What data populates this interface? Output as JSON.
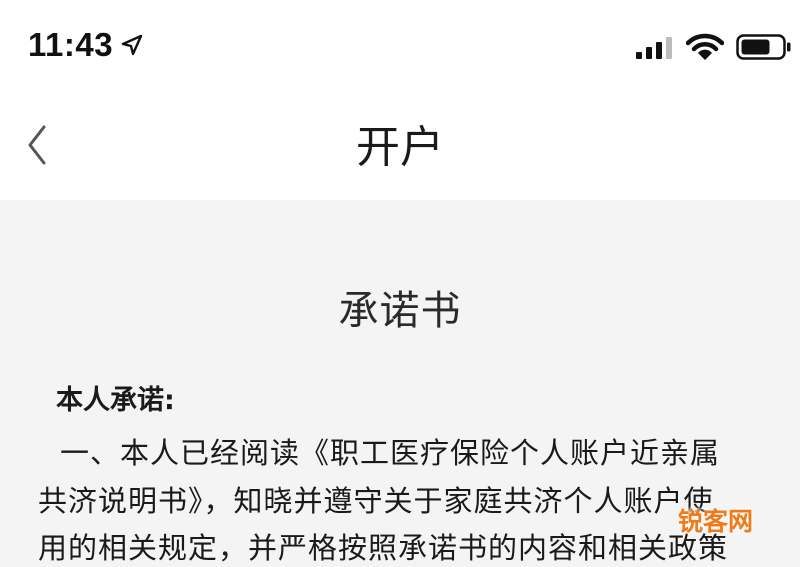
{
  "status_bar": {
    "time": "11:43",
    "icons": [
      "location-arrow-icon",
      "cellular-signal-icon",
      "wifi-icon",
      "battery-icon"
    ]
  },
  "nav": {
    "back_icon": "chevron-left-icon",
    "title": "开户"
  },
  "document": {
    "title": "承诺书",
    "heading": "本人承诺:",
    "lines": [
      "一、本人已经阅读《职工医疗保险个人账户近亲属",
      "共济说明书》，知晓并遵守关于家庭共济个人账户使",
      "用的相关规定，并严格按照承诺书的内容和相关政策"
    ]
  },
  "watermark": "锐客网",
  "colors": {
    "bar_background": "#ffffff",
    "content_background": "#f4f4f4",
    "watermark": "#f07a1a"
  }
}
